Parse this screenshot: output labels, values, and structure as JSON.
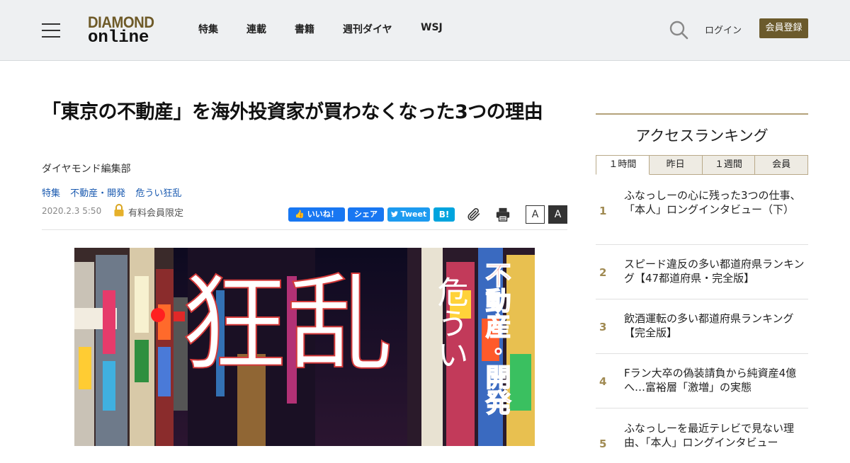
{
  "header": {
    "logo_top": "DIAMOND",
    "logo_bottom": "online",
    "nav": [
      "特集",
      "連載",
      "書籍",
      "週刊ダイヤ",
      "WSJ"
    ],
    "login_label": "ログイン",
    "register_label": "会員登録"
  },
  "article": {
    "title": "「東京の不動産」を海外投資家が買わなくなった3つの理由",
    "author": "ダイヤモンド編集部",
    "tags": [
      "特集",
      "不動産・開発",
      "危うい狂乱"
    ],
    "date": "2020.2.3 5:50",
    "paid_label": "有料会員限定",
    "share": {
      "fb_like": "いいね！",
      "fb_share": "シェア",
      "tweet": "Tweet",
      "hatena": "B!"
    },
    "font_small": "A",
    "font_large": "A",
    "hero": {
      "headline": "狂乱",
      "sub": "危うい",
      "category": "不動産・開発"
    }
  },
  "ranking": {
    "title": "アクセスランキング",
    "tabs": [
      "１時間",
      "昨日",
      "１週間",
      "会員"
    ],
    "items": [
      {
        "rank": "1",
        "text": "ふなっしーの心に残った3つの仕事、「本人」ロングインタビュー（下）"
      },
      {
        "rank": "2",
        "text": "スピード違反の多い都道府県ランキング【47都道府県・完全版】"
      },
      {
        "rank": "3",
        "text": "飲酒運転の多い都道府県ランキング【完全版】"
      },
      {
        "rank": "4",
        "text": "Fラン大卒の偽装請負から純資産4億へ…富裕層「激増」の実態"
      },
      {
        "rank": "5",
        "text": "ふなっしーを最近テレビで見ない理由、「本人」ロングインタビュー"
      }
    ]
  },
  "colors": {
    "brand_gold": "#6b5a2c",
    "link_blue": "#1a5ab0",
    "facebook": "#1877f2",
    "twitter": "#1d9bf0",
    "hatena": "#00a4de"
  }
}
